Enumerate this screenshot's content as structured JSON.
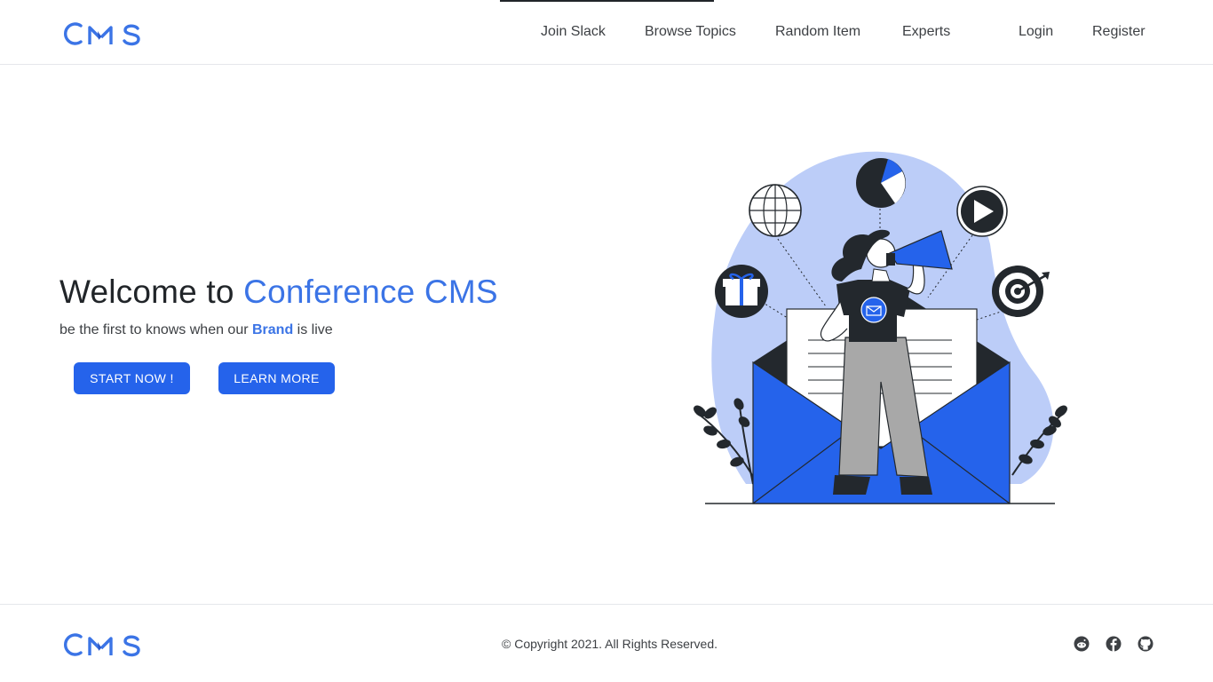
{
  "header": {
    "logo_text": "CMS",
    "nav": [
      "Join Slack",
      "Browse Topics",
      "Random Item",
      "Experts"
    ],
    "auth": [
      "Login",
      "Register"
    ]
  },
  "hero": {
    "title_prefix": "Welcome to ",
    "title_accent": "Conference CMS",
    "subtitle_prefix": "be the first to knows when our ",
    "subtitle_brand": "Brand",
    "subtitle_suffix": " is live",
    "start_label": "START NOW !",
    "learn_label": "LEARN MORE",
    "illustration_icon": "marketing-megaphone-illustration"
  },
  "footer": {
    "logo_text": "CMS",
    "copyright": "© Copyright 2021. All Rights Reserved.",
    "social_icons": [
      "reddit-icon",
      "facebook-icon",
      "github-icon"
    ]
  },
  "colors": {
    "accent": "#3b74e6",
    "button": "#2563eb",
    "blob": "#bccdf8",
    "dark": "#23282d"
  }
}
